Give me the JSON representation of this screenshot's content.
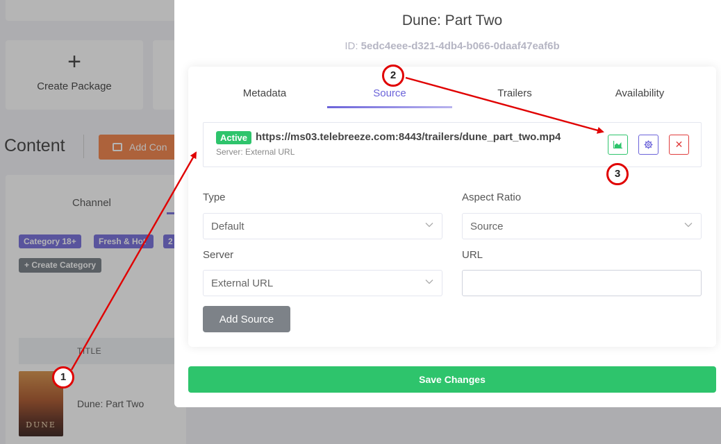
{
  "background": {
    "create_package": "Create Package",
    "content_title": "Content",
    "add_content": "Add Con",
    "tab_channel": "Channel",
    "categories": [
      "Category 18+",
      "Fresh & Hot",
      "2"
    ],
    "create_category": "+ Create Category",
    "table_header_title": "TITLE",
    "row_title": "Dune: Part Two",
    "poster_text": "DUNE"
  },
  "modal": {
    "title": "Dune: Part Two",
    "id_label": "ID: ",
    "id_value": "5edc4eee-d321-4db4-b066-0daaf47eaf6b",
    "tabs": [
      "Metadata",
      "Source",
      "Trailers",
      "Availability"
    ],
    "active_tab": "Source",
    "source": {
      "status": "Active",
      "url": "https://ms03.telebreeze.com:8443/trailers/dune_part_two.mp4",
      "server": "Server: External URL"
    },
    "form": {
      "type_label": "Type",
      "type_value": "Default",
      "aspect_label": "Aspect Ratio",
      "aspect_value": "Source",
      "server_label": "Server",
      "server_value": "External URL",
      "url_label": "URL",
      "url_value": ""
    },
    "add_source": "Add Source",
    "save_changes": "Save Changes"
  },
  "annotations": [
    "1",
    "2",
    "3"
  ],
  "colors": {
    "accent": "#6b63d9",
    "success": "#2ec46c",
    "danger": "#e03c3c",
    "annotation": "#e00000"
  }
}
